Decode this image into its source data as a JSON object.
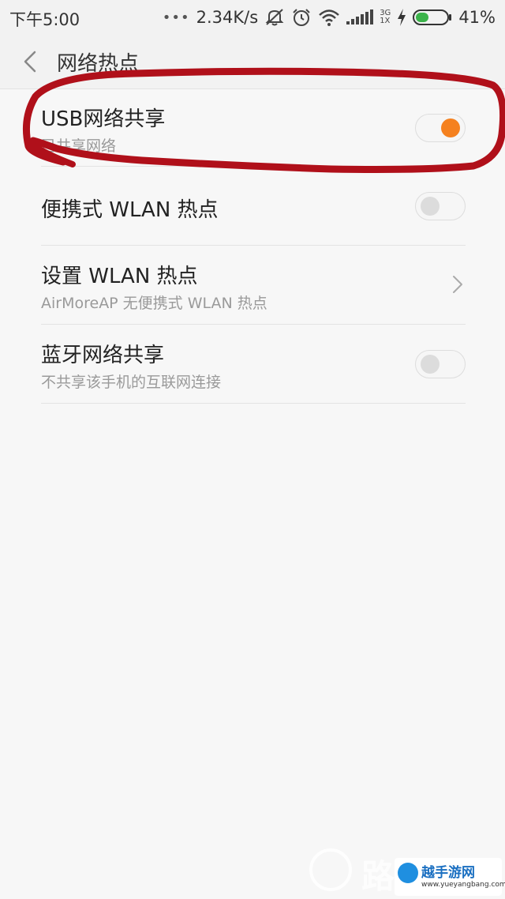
{
  "status_bar": {
    "time": "下午5:00",
    "dots": "•••",
    "speed": "2.34K/s",
    "net_type_top": "3G",
    "net_type_bottom": "1X",
    "battery_percent": "41%",
    "battery_level": 0.41,
    "icons": [
      "mute-icon",
      "alarm-icon",
      "wifi-icon",
      "signal-icon",
      "charging-icon",
      "battery-icon"
    ]
  },
  "header": {
    "back_icon": "chevron-left-icon",
    "title": "网络热点"
  },
  "settings": [
    {
      "id": "usb",
      "title": "USB网络共享",
      "subtitle": "已共享网络",
      "control": "toggle",
      "enabled": true
    },
    {
      "id": "portable",
      "title": "便携式 WLAN 热点",
      "subtitle": "",
      "control": "toggle",
      "enabled": false
    },
    {
      "id": "setup",
      "title": "设置 WLAN 热点",
      "subtitle": "AirMoreAP 无便携式 WLAN 热点",
      "control": "chevron"
    },
    {
      "id": "bluetooth",
      "title": "蓝牙网络共享",
      "subtitle": "不共享该手机的互联网连接",
      "control": "toggle",
      "enabled": false
    }
  ],
  "colors": {
    "accent": "#f5811f",
    "annotation": "#b0101a",
    "background": "#f7f7f7"
  },
  "watermark": {
    "big_text": "路由器",
    "badge_name": "越手游网",
    "badge_url": "www.yueyangbang.com"
  }
}
